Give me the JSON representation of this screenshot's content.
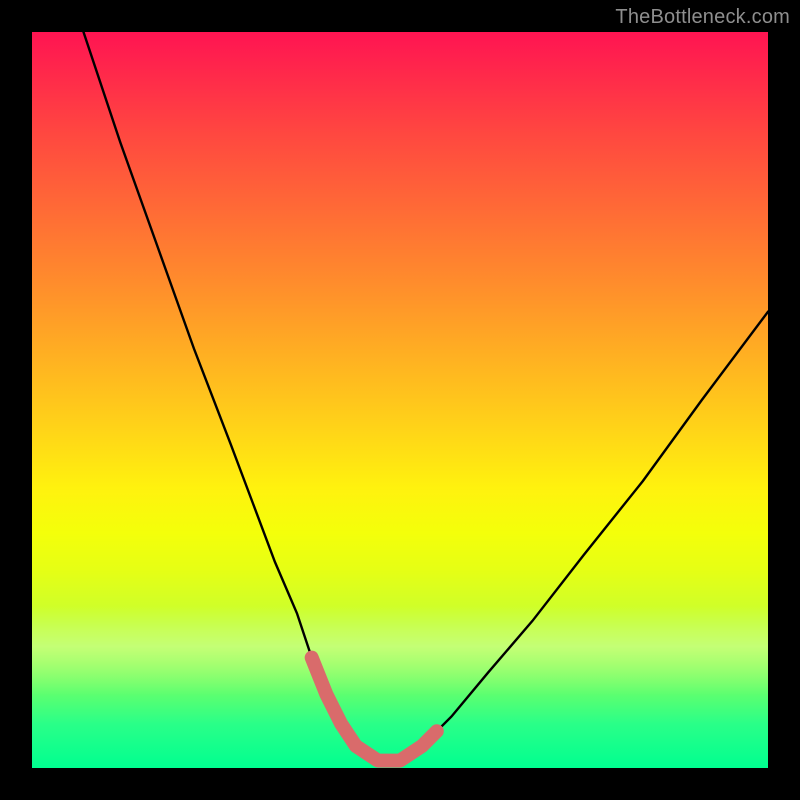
{
  "watermark": "TheBottleneck.com",
  "chart_data": {
    "type": "line",
    "title": "",
    "xlabel": "",
    "ylabel": "",
    "xlim": [
      0,
      100
    ],
    "ylim": [
      0,
      100
    ],
    "grid": false,
    "legend": false,
    "annotations": [],
    "note": "V-shaped bottleneck curve. Values are approximate, read from pixel positions; axes carry no numeric tick labels in the source image, so x and y are normalized 0–100.",
    "series": [
      {
        "name": "curve",
        "x": [
          7,
          12,
          17,
          22,
          27,
          30,
          33,
          36,
          38,
          40,
          42,
          44,
          47,
          50,
          53,
          57,
          62,
          68,
          75,
          83,
          91,
          100
        ],
        "y": [
          100,
          85,
          71,
          57,
          44,
          36,
          28,
          21,
          15,
          10,
          6,
          3,
          1,
          1,
          3,
          7,
          13,
          20,
          29,
          39,
          50,
          62
        ]
      },
      {
        "name": "trough-highlight",
        "x": [
          38,
          40,
          42,
          44,
          47,
          50,
          53,
          55
        ],
        "y": [
          15,
          10,
          6,
          3,
          1,
          1,
          3,
          5
        ]
      }
    ]
  }
}
